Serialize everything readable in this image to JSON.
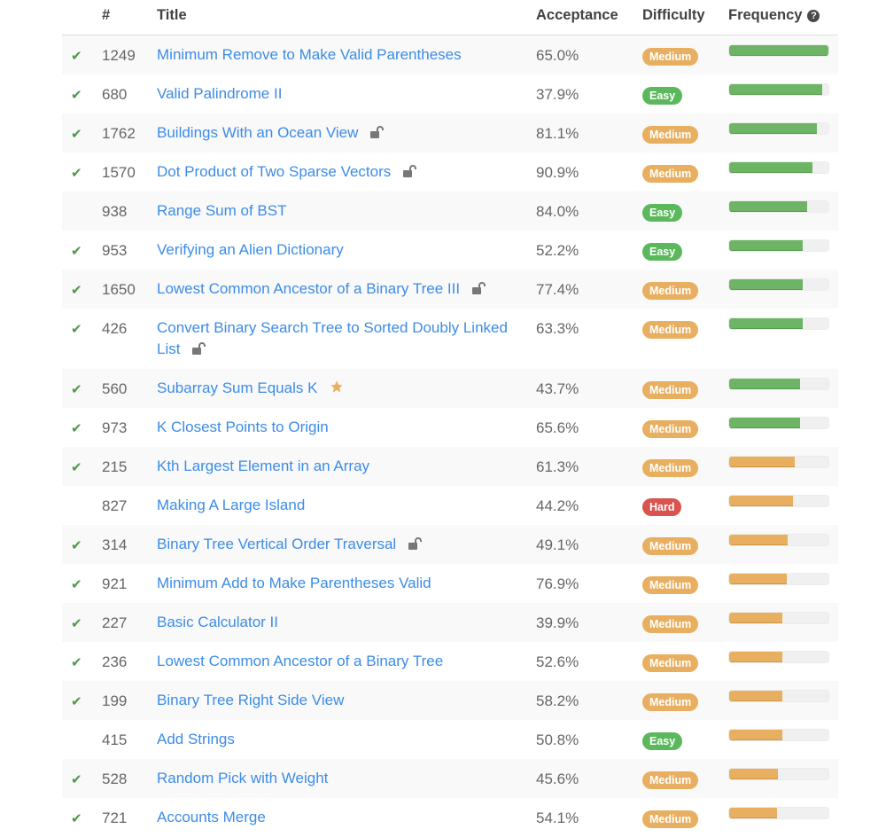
{
  "header": {
    "num": "#",
    "title": "Title",
    "acceptance": "Acceptance",
    "difficulty": "Difficulty",
    "frequency": "Frequency",
    "help_icon": "question-circle-icon"
  },
  "colors": {
    "link": "#3c8ce7",
    "check": "#4a9a45",
    "medium": "#e7af5f",
    "easy": "#5cb85c",
    "hard": "#d9534f",
    "freq_high": "#6db565",
    "freq_mid": "#e7af5f"
  },
  "rows": [
    {
      "solved": true,
      "num": "1249",
      "title": "Minimum Remove to Make Valid Parentheses",
      "icon": null,
      "acceptance": "65.0%",
      "difficulty": "Medium",
      "frequency": 1.0,
      "freq_color": "green"
    },
    {
      "solved": true,
      "num": "680",
      "title": "Valid Palindrome II",
      "icon": null,
      "acceptance": "37.9%",
      "difficulty": "Easy",
      "frequency": 0.94,
      "freq_color": "green"
    },
    {
      "solved": true,
      "num": "1762",
      "title": "Buildings With an Ocean View",
      "icon": "unlock-icon",
      "acceptance": "81.1%",
      "difficulty": "Medium",
      "frequency": 0.88,
      "freq_color": "green"
    },
    {
      "solved": true,
      "num": "1570",
      "title": "Dot Product of Two Sparse Vectors",
      "icon": "unlock-icon",
      "acceptance": "90.9%",
      "difficulty": "Medium",
      "frequency": 0.84,
      "freq_color": "green"
    },
    {
      "solved": false,
      "num": "938",
      "title": "Range Sum of BST",
      "icon": null,
      "acceptance": "84.0%",
      "difficulty": "Easy",
      "frequency": 0.79,
      "freq_color": "green"
    },
    {
      "solved": true,
      "num": "953",
      "title": "Verifying an Alien Dictionary",
      "icon": null,
      "acceptance": "52.2%",
      "difficulty": "Easy",
      "frequency": 0.74,
      "freq_color": "green"
    },
    {
      "solved": true,
      "num": "1650",
      "title": "Lowest Common Ancestor of a Binary Tree III",
      "icon": "unlock-icon",
      "acceptance": "77.4%",
      "difficulty": "Medium",
      "frequency": 0.74,
      "freq_color": "green"
    },
    {
      "solved": true,
      "num": "426",
      "title": "Convert Binary Search Tree to Sorted Doubly Linked List",
      "icon": "unlock-icon",
      "acceptance": "63.3%",
      "difficulty": "Medium",
      "frequency": 0.74,
      "freq_color": "green",
      "tall": true
    },
    {
      "solved": true,
      "num": "560",
      "title": "Subarray Sum Equals K",
      "icon": "star-icon",
      "acceptance": "43.7%",
      "difficulty": "Medium",
      "frequency": 0.71,
      "freq_color": "green"
    },
    {
      "solved": true,
      "num": "973",
      "title": "K Closest Points to Origin",
      "icon": null,
      "acceptance": "65.6%",
      "difficulty": "Medium",
      "frequency": 0.71,
      "freq_color": "green"
    },
    {
      "solved": true,
      "num": "215",
      "title": "Kth Largest Element in an Array",
      "icon": null,
      "acceptance": "61.3%",
      "difficulty": "Medium",
      "frequency": 0.66,
      "freq_color": "orange"
    },
    {
      "solved": false,
      "num": "827",
      "title": "Making A Large Island",
      "icon": null,
      "acceptance": "44.2%",
      "difficulty": "Hard",
      "frequency": 0.64,
      "freq_color": "orange"
    },
    {
      "solved": true,
      "num": "314",
      "title": "Binary Tree Vertical Order Traversal",
      "icon": "unlock-icon",
      "acceptance": "49.1%",
      "difficulty": "Medium",
      "frequency": 0.59,
      "freq_color": "orange"
    },
    {
      "solved": true,
      "num": "921",
      "title": "Minimum Add to Make Parentheses Valid",
      "icon": null,
      "acceptance": "76.9%",
      "difficulty": "Medium",
      "frequency": 0.58,
      "freq_color": "orange"
    },
    {
      "solved": true,
      "num": "227",
      "title": "Basic Calculator II",
      "icon": null,
      "acceptance": "39.9%",
      "difficulty": "Medium",
      "frequency": 0.54,
      "freq_color": "orange"
    },
    {
      "solved": true,
      "num": "236",
      "title": "Lowest Common Ancestor of a Binary Tree",
      "icon": null,
      "acceptance": "52.6%",
      "difficulty": "Medium",
      "frequency": 0.54,
      "freq_color": "orange"
    },
    {
      "solved": true,
      "num": "199",
      "title": "Binary Tree Right Side View",
      "icon": null,
      "acceptance": "58.2%",
      "difficulty": "Medium",
      "frequency": 0.54,
      "freq_color": "orange"
    },
    {
      "solved": false,
      "num": "415",
      "title": "Add Strings",
      "icon": null,
      "acceptance": "50.8%",
      "difficulty": "Easy",
      "frequency": 0.54,
      "freq_color": "orange"
    },
    {
      "solved": true,
      "num": "528",
      "title": "Random Pick with Weight",
      "icon": null,
      "acceptance": "45.6%",
      "difficulty": "Medium",
      "frequency": 0.49,
      "freq_color": "orange"
    },
    {
      "solved": true,
      "num": "721",
      "title": "Accounts Merge",
      "icon": null,
      "acceptance": "54.1%",
      "difficulty": "Medium",
      "frequency": 0.48,
      "freq_color": "orange"
    }
  ]
}
